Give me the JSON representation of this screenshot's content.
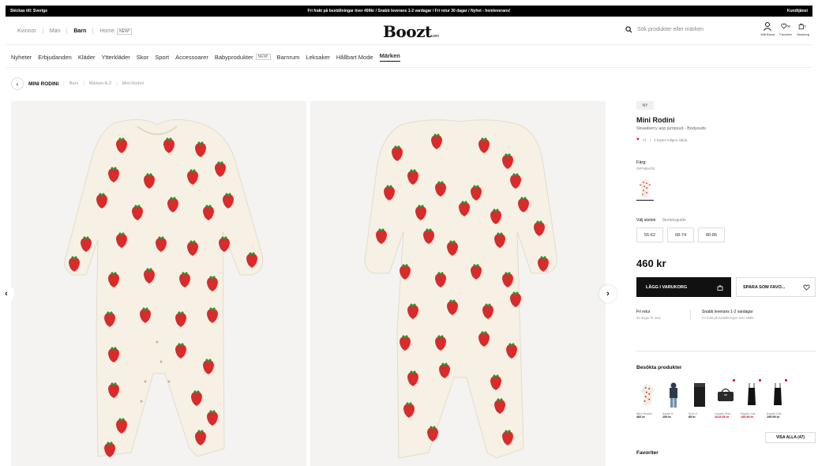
{
  "topbar": {
    "left": "Skickas till: Sverige",
    "center": "Fri frakt på beställningar över 499kr  /  Snabb leverans 1-2 vardagar  /  Fri retur 30 dagar / Nyhet - hemleverans!",
    "right": "Kundtjänst"
  },
  "header": {
    "genders": [
      "Kvinnor",
      "Män",
      "Barn",
      "Home"
    ],
    "home_badge": "NEW!",
    "logo": "Boozt",
    "logo_suffix": ".com",
    "search_placeholder": "Sök produkter eller märken",
    "icons": [
      {
        "label": "Mitt Boozt",
        "icon": "user-icon"
      },
      {
        "label": "Favoriter",
        "icon": "heart-icon"
      },
      {
        "label": "Varukorg",
        "icon": "bag-icon"
      }
    ],
    "fav_count": "56",
    "cart_count": "0"
  },
  "catnav": {
    "items": [
      "Nyheter",
      "Erbjudanden",
      "Kläder",
      "Ytterkläder",
      "Skor",
      "Sport",
      "Accessoarer",
      "Babyprodukter",
      "Barnrum",
      "Leksaker",
      "Hållbart Mode",
      "Märken"
    ],
    "baby_badge": "NEW!",
    "active": "Märken"
  },
  "breadcrumb": {
    "brand": "MINI RODINI",
    "items": [
      "Barn",
      "Märken A-Z",
      "Mini Rodini"
    ]
  },
  "product": {
    "badge": "NY",
    "brand": "Mini Rodini",
    "subtitle": "Strawberry aop jumpsuit - Bodysuits",
    "fav_count": "71",
    "stock_text": "4 Styles tullgen sålda",
    "color_label": "Färg:",
    "color_value": "OFFWHITE",
    "size_label": "Välj storlek",
    "size_guide": "Storleksguide",
    "sizes": [
      "56-62",
      "68-74",
      "80-86"
    ],
    "price": "460 kr",
    "add_to_cart": "LÄGG I VARUKORG",
    "save_fav": "SPARA SOM FAVO...",
    "info1_title": "Fri retur",
    "info1_sub": "30 dagar fri retur",
    "info2_title": "Snabb leverans 1-2 vardagar",
    "info2_sub": "Fri frakt på beställningar över 499kr"
  },
  "visited": {
    "title": "Besökta produkter",
    "items": [
      {
        "name": "Mini Rodini",
        "price": "460 kr",
        "sale": false
      },
      {
        "name": "name it",
        "price": "159 kr",
        "sale": false
      },
      {
        "name": "W.A.C.",
        "price": "85 kr",
        "sale": false
      },
      {
        "name": "Lauren Ral...",
        "price": "1615.95 kr",
        "sale": true
      },
      {
        "name": "Esprit Coll...",
        "price": "159.99 kr",
        "sale": true
      },
      {
        "name": "Esprit Coll...",
        "price": "199.95 kr",
        "sale": false
      }
    ],
    "view_all": "VISA ALLA (47)"
  },
  "favorites_title": "Favoriter",
  "colors": {
    "strawberry": "#d92b2b",
    "leaf": "#3a8a2e",
    "fabric": "#f6f1e4",
    "sale": "#d0021b"
  }
}
